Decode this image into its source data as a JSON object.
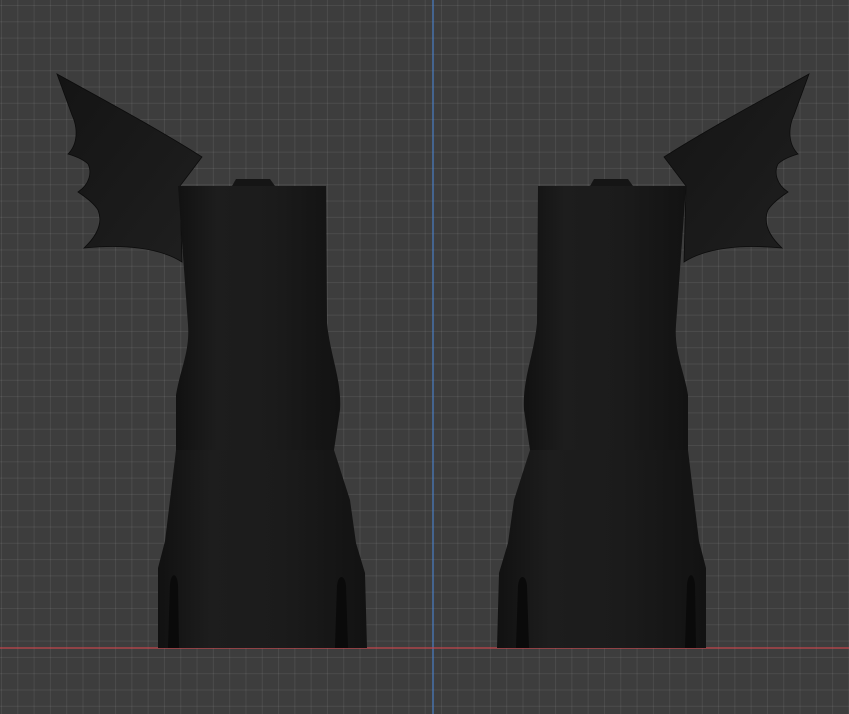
{
  "viewport": {
    "view_type": "orthographic-front",
    "background_color": "#3d3d3d",
    "grid_color": "#4a4a4a",
    "x_axis_color": "#c2464d",
    "z_axis_color": "#4a7fc6",
    "object_color": "#1a1a1a"
  },
  "scene": {
    "objects": [
      {
        "name": "boot-left",
        "mirrored": false
      },
      {
        "name": "boot-right",
        "mirrored": true
      }
    ]
  }
}
